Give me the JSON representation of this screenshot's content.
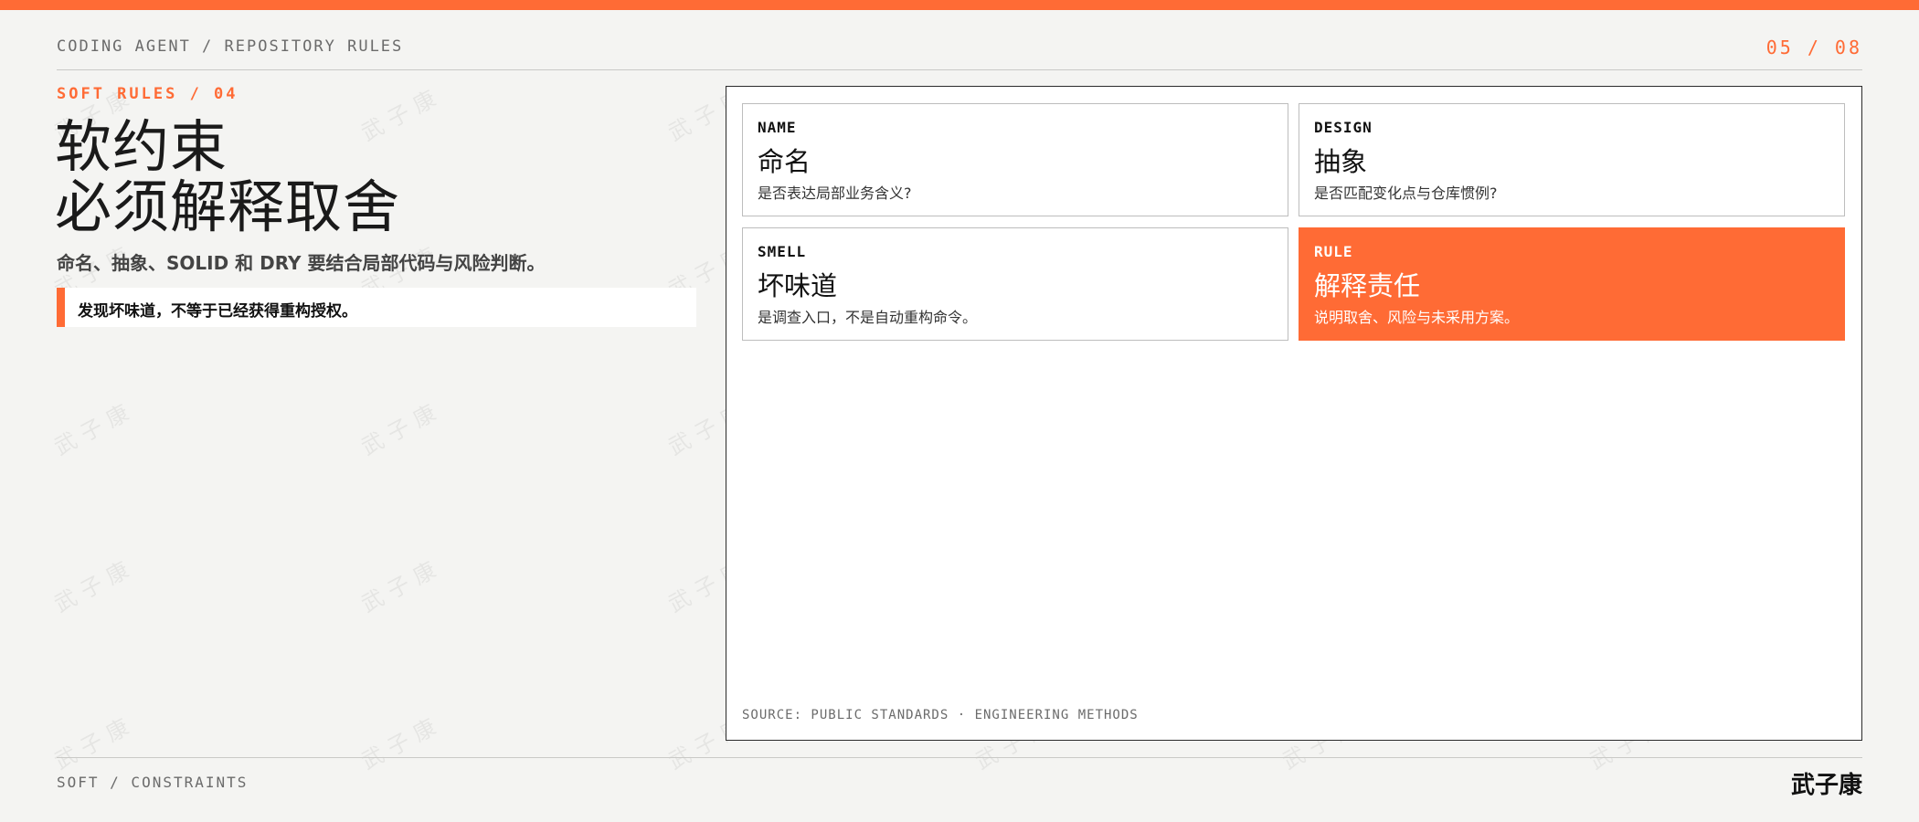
{
  "header": {
    "breadcrumb": "CODING AGENT / REPOSITORY RULES",
    "page_indicator": "05 / 08"
  },
  "left": {
    "eyebrow": "SOFT RULES / 04",
    "headline_line1": "软约束",
    "headline_line2": "必须解释取舍",
    "subtitle": "命名、抽象、SOLID 和 DRY 要结合局部代码与风险判断。",
    "callout": "发现坏味道，不等于已经获得重构授权。"
  },
  "cards": [
    {
      "tag": "NAME",
      "title": "命名",
      "desc": "是否表达局部业务含义?"
    },
    {
      "tag": "DESIGN",
      "title": "抽象",
      "desc": "是否匹配变化点与仓库惯例?"
    },
    {
      "tag": "SMELL",
      "title": "坏味道",
      "desc": "是调查入口，不是自动重构命令。"
    },
    {
      "tag": "RULE",
      "title": "解释责任",
      "desc": "说明取舍、风险与未采用方案。"
    }
  ],
  "panel": {
    "source": "SOURCE: PUBLIC STANDARDS · ENGINEERING METHODS"
  },
  "footer": {
    "section": "SOFT / CONSTRAINTS",
    "author": "武子康"
  },
  "watermark": "武子康",
  "colors": {
    "accent": "#ff6b35",
    "background": "#f4f4f2",
    "panel": "#ffffff"
  }
}
